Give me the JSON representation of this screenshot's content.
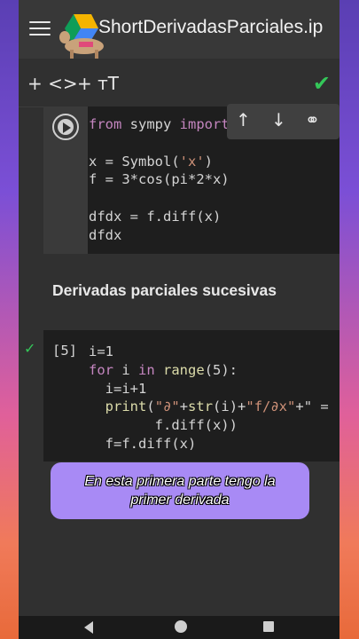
{
  "app": {
    "title": "ShortDerivadasParciales.ip"
  },
  "toolbar": {
    "add_code_label": "+ <>",
    "add_text_label": "+ тT"
  },
  "cell_toolbar": {
    "move_up": "↑",
    "move_down": "↓",
    "link": "⚭"
  },
  "cell1": {
    "lines": [
      "from sympy import *",
      "",
      "x = Symbol('x')",
      "f = 3*cos(pi*2*x)",
      "",
      "dfdx = f.diff(x)",
      "dfdx"
    ]
  },
  "section": {
    "heading": "Derivadas parciales sucesivas"
  },
  "cell2": {
    "exec_count": "[5]",
    "lines": [
      "i=1",
      "for i in range(5):",
      "  i=i+1",
      "  print(\"∂\"+str(i)+\"f/∂x\"+\" =",
      "        f.diff(x))",
      "  f=f.diff(x)"
    ]
  },
  "caption": {
    "line1": "En esta primera parte tengo la",
    "line2": "primer derivada"
  },
  "colors": {
    "accent_green": "#34c759",
    "caption_bg": "#a88af5",
    "keyword": "#c586c0",
    "string": "#ce9178"
  }
}
